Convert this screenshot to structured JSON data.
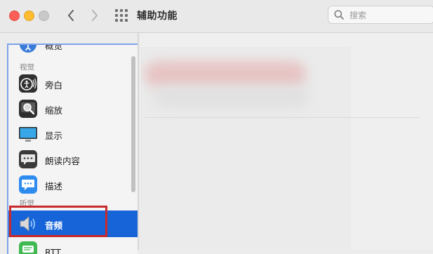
{
  "window": {
    "title": "辅助功能",
    "search_placeholder": "搜索"
  },
  "sidebar": {
    "partial_top_item": "概览",
    "sections": [
      {
        "header": "视觉",
        "items": [
          {
            "label": "旁白",
            "icon": "voiceover-icon"
          },
          {
            "label": "缩放",
            "icon": "zoom-icon"
          },
          {
            "label": "显示",
            "icon": "display-icon"
          },
          {
            "label": "朗读内容",
            "icon": "spoken-content-icon"
          },
          {
            "label": "描述",
            "icon": "descriptions-icon"
          }
        ]
      },
      {
        "header": "听觉",
        "items": [
          {
            "label": "音频",
            "icon": "audio-icon",
            "selected": true
          },
          {
            "label": "RTT",
            "icon": "rtt-icon"
          }
        ]
      }
    ]
  },
  "colors": {
    "selection": "#1764d9",
    "highlight_annotation": "#c92b2b"
  }
}
